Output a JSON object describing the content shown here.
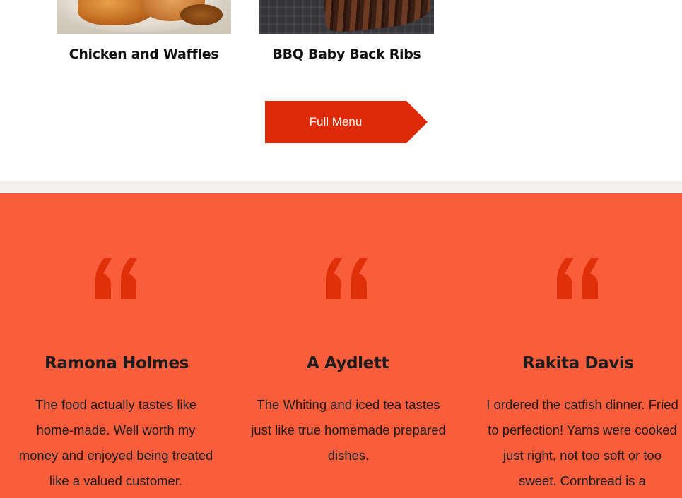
{
  "menu": {
    "items": [
      {
        "name": "Chicken and Waffles"
      },
      {
        "name": "BBQ Baby Back Ribs"
      }
    ],
    "full_menu_label": "Full Menu"
  },
  "reviews": {
    "quote_icon": "quote-mark-icon",
    "items": [
      {
        "name": "Ramona Holmes",
        "text": "The food actually tastes like home-made. Well worth my money and enjoyed being treated like a valued customer."
      },
      {
        "name": "A Aydlett",
        "text": "The Whiting and iced tea tastes just like true homemade prepared dishes."
      },
      {
        "name": "Rakita Davis",
        "text": "I ordered the catfish dinner. Fried to perfection! Yams were cooked just right, not too soft or too sweet. Cornbread is a"
      }
    ]
  },
  "colors": {
    "accent": "#dd2a07",
    "reviews_background": "#fa5d3c",
    "separator": "#f3f1ee",
    "text_dark": "#111111"
  }
}
